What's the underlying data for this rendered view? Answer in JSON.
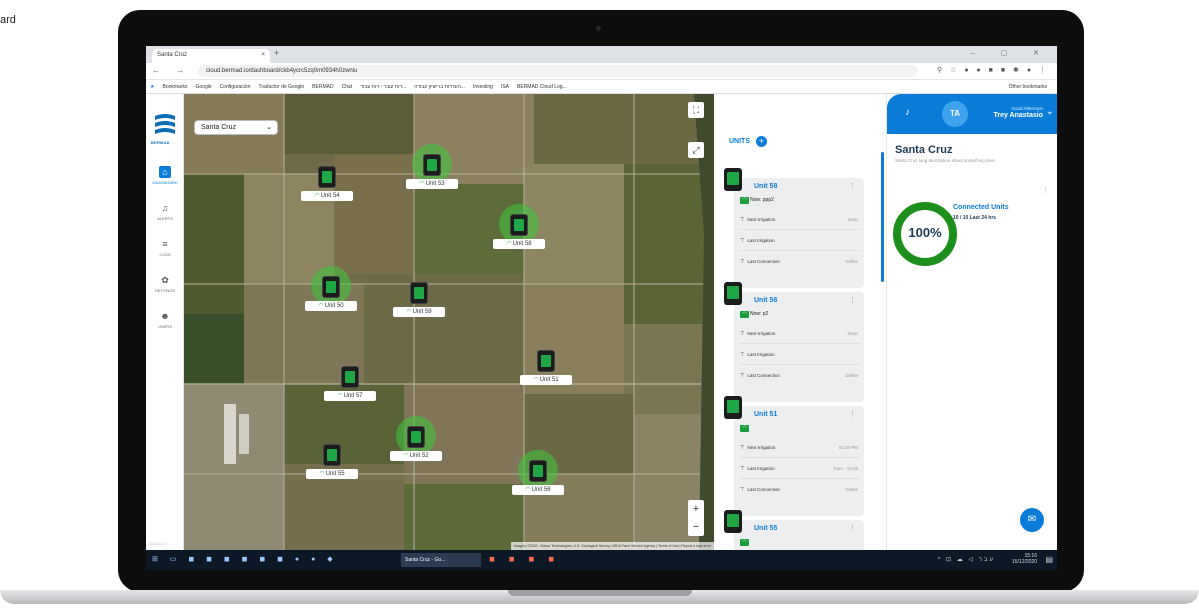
{
  "page_corner_text": "ard",
  "browser": {
    "tab_title": "Santa Cruz",
    "tab_close": "×",
    "new_tab": "+",
    "url": "cloud.bermad.io/dashboard/ckb4ycrc5zq0m0934h0zwniu",
    "bookmarks": [
      "Bookmarks",
      "Google",
      "Configuración",
      "Traductor de Google",
      "BERMAD",
      "Chat",
      "דוח עובד - דוח עבוד...",
      "העדרות ברישיון עבודה...",
      "Investing",
      "ISA",
      "BERMAD Cloud Log..."
    ],
    "other_bookmarks": "Other bookmarks"
  },
  "sidebar": {
    "logo_text": "BERMAD",
    "items": [
      {
        "label": "DASHBOARD",
        "icon": "home-icon"
      },
      {
        "label": "ALERTS",
        "icon": "bell-icon"
      },
      {
        "label": "LOGS",
        "icon": "list-icon"
      },
      {
        "label": "SETTINGS",
        "icon": "gear-icon"
      },
      {
        "label": "USERS",
        "icon": "users-icon"
      }
    ],
    "version": "2020.12.0"
  },
  "map": {
    "site_select": "Santa Cruz",
    "zoom_in": "+",
    "zoom_out": "−",
    "attribution": "Imagery ©2020 , Maxar Technologies, U.S. Geological Survey, USDA Farm Service Agency | Terms of Use | Report a map error",
    "markers": [
      {
        "label": "Unit 54",
        "active": false
      },
      {
        "label": "Unit 53",
        "active": true
      },
      {
        "label": "Unit 58",
        "active": true
      },
      {
        "label": "Unit 50",
        "active": true
      },
      {
        "label": "Unit 59",
        "active": false
      },
      {
        "label": "Unit 51",
        "active": false
      },
      {
        "label": "Unit 57",
        "active": false
      },
      {
        "label": "Unit 52",
        "active": true
      },
      {
        "label": "Unit 55",
        "active": false
      },
      {
        "label": "Unit 56",
        "active": true
      }
    ]
  },
  "units": {
    "title": "UNITS",
    "add": "+",
    "cards": [
      {
        "name": "Unit 58",
        "status": "Now: ppp2",
        "rows": [
          {
            "label": "Next Irrigation",
            "value": "Soon"
          },
          {
            "label": "Last Irrigation",
            "value": ""
          },
          {
            "label": "Last Connection",
            "value": "Online"
          }
        ]
      },
      {
        "name": "Unit 56",
        "status": "Now: p2",
        "rows": [
          {
            "label": "Next Irrigation",
            "value": "Soon"
          },
          {
            "label": "Last Irrigation",
            "value": ""
          },
          {
            "label": "Last Connection",
            "value": "Online"
          }
        ]
      },
      {
        "name": "Unit 51",
        "status": "",
        "rows": [
          {
            "label": "Next Irrigation",
            "value": "00:20 PM"
          },
          {
            "label": "Last Irrigation",
            "value": "Tues - 14:29"
          },
          {
            "label": "Last Connection",
            "value": "Online"
          }
        ]
      },
      {
        "name": "Unit 55",
        "status": "",
        "rows": []
      }
    ]
  },
  "right_panel": {
    "greeting": "Good Afternoon",
    "user_name": "Trey Anastasio",
    "initials": "TA",
    "site_title": "Santa Cruz",
    "site_desc": "Santa Cruz long description about something desc",
    "connected_label": "Connected Units",
    "connected_sub": "10 / 10 Last 24 hrs",
    "connected_pct": "100%"
  },
  "taskbar": {
    "app_label": "Santa Cruz - Go...",
    "time": "15:16",
    "date": "15/12/2020",
    "lang": "עבר"
  },
  "colors": {
    "accent": "#0b7dd9",
    "online": "#1c8f1c",
    "device": "#1fa745"
  }
}
